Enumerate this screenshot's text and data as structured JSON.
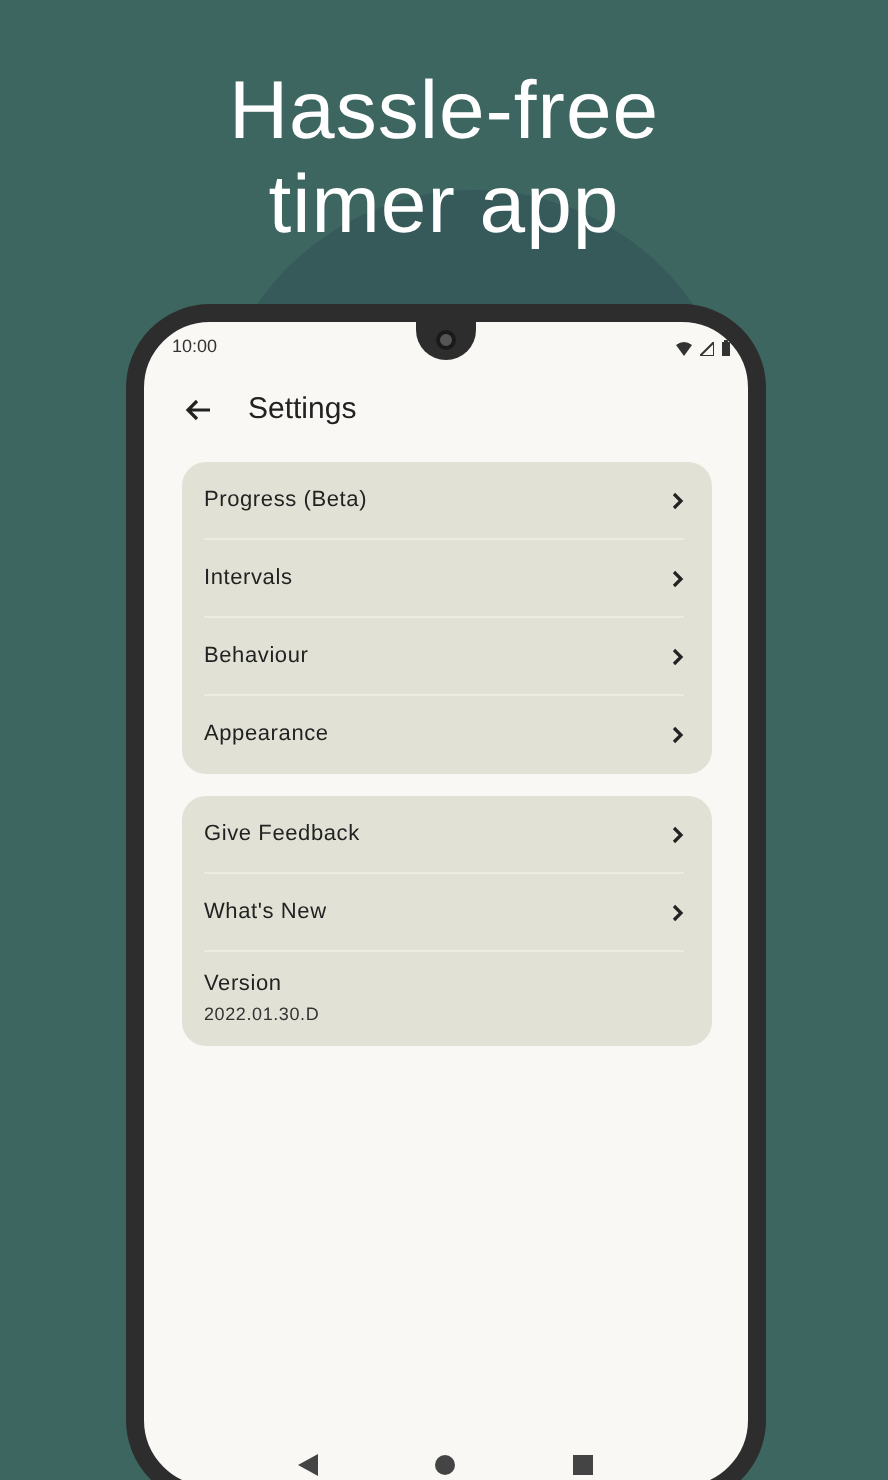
{
  "headline_lines": [
    "Hassle-free",
    "timer app"
  ],
  "status_bar": {
    "time": "10:00"
  },
  "toolbar": {
    "title": "Settings"
  },
  "groups": [
    {
      "items": [
        {
          "kind": "link",
          "label": "Progress (Beta)"
        },
        {
          "kind": "link",
          "label": "Intervals"
        },
        {
          "kind": "link",
          "label": "Behaviour"
        },
        {
          "kind": "link",
          "label": "Appearance"
        }
      ]
    },
    {
      "items": [
        {
          "kind": "link",
          "label": "Give Feedback"
        },
        {
          "kind": "link",
          "label": "What's New"
        },
        {
          "kind": "info",
          "label": "Version",
          "value": "2022.01.30.D"
        }
      ]
    }
  ]
}
